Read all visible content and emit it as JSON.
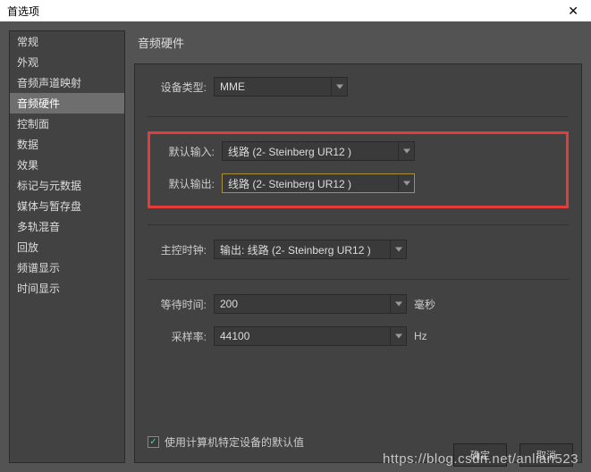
{
  "window": {
    "title": "首选项"
  },
  "sidebar": {
    "items": [
      {
        "label": "常规"
      },
      {
        "label": "外观"
      },
      {
        "label": "音频声道映射"
      },
      {
        "label": "音频硬件"
      },
      {
        "label": "控制面"
      },
      {
        "label": "数据"
      },
      {
        "label": "效果"
      },
      {
        "label": "标记与元数据"
      },
      {
        "label": "媒体与暂存盘"
      },
      {
        "label": "多轨混音"
      },
      {
        "label": "回放"
      },
      {
        "label": "频谱显示"
      },
      {
        "label": "时间显示"
      }
    ],
    "selected_index": 3
  },
  "section": {
    "title": "音频硬件"
  },
  "form": {
    "device_type": {
      "label": "设备类型:",
      "value": "MME"
    },
    "default_input": {
      "label": "默认输入:",
      "value": "线路 (2- Steinberg UR12 )"
    },
    "default_output": {
      "label": "默认输出:",
      "value": "线路 (2- Steinberg UR12 )"
    },
    "master_clock": {
      "label": "主控时钟:",
      "value": "输出: 线路 (2- Steinberg UR12 )"
    },
    "latency": {
      "label": "等待时间:",
      "value": "200",
      "unit": "毫秒"
    },
    "sample_rate": {
      "label": "采样率:",
      "value": "44100",
      "unit": "Hz"
    },
    "use_device_defaults": {
      "label": "使用计算机特定设备的默认值",
      "checked": true
    }
  },
  "footer": {
    "ok": "确定",
    "cancel": "取消"
  },
  "watermark": "https://blog.csdn.net/anlian523"
}
